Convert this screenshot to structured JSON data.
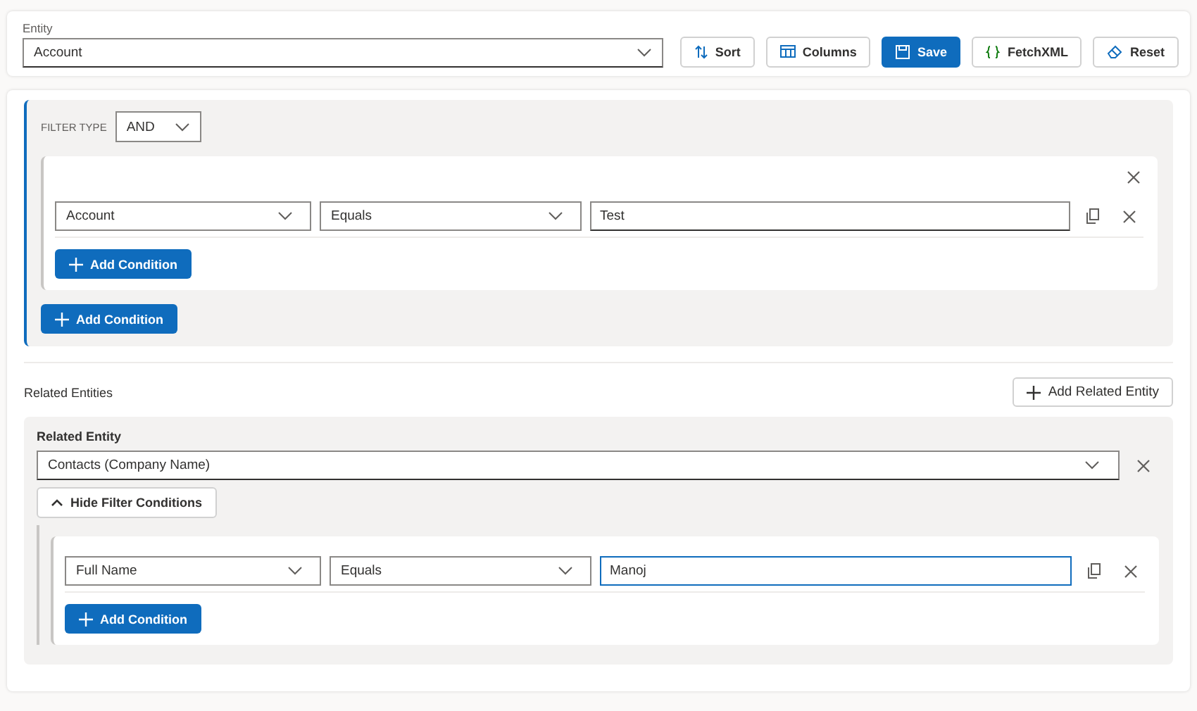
{
  "entity": {
    "label": "Entity",
    "value": "Account"
  },
  "toolbar": [
    {
      "kind": "sort",
      "label": "Sort"
    },
    {
      "kind": "columns",
      "label": "Columns"
    },
    {
      "kind": "save",
      "label": "Save"
    },
    {
      "kind": "fetchxml",
      "label": "FetchXML"
    },
    {
      "kind": "reset",
      "label": "Reset"
    }
  ],
  "filter": {
    "type_label": "FILTER TYPE",
    "type_value": "AND",
    "groups": [
      {
        "conditions": [
          {
            "field": "Account",
            "operator": "Equals",
            "value": "Test",
            "focused": false
          }
        ],
        "add_label": "Add Condition"
      }
    ],
    "add_label": "Add Condition"
  },
  "related": {
    "title": "Related Entities",
    "add_label": "Add Related Entity",
    "entities": [
      {
        "label": "Related Entity",
        "value": "Contacts (Company Name)",
        "toggle_label": "Hide Filter Conditions",
        "expanded": true,
        "conditions": [
          {
            "field": "Full Name",
            "operator": "Equals",
            "value": "Manoj",
            "focused": true
          }
        ],
        "add_label": "Add Condition"
      }
    ]
  }
}
